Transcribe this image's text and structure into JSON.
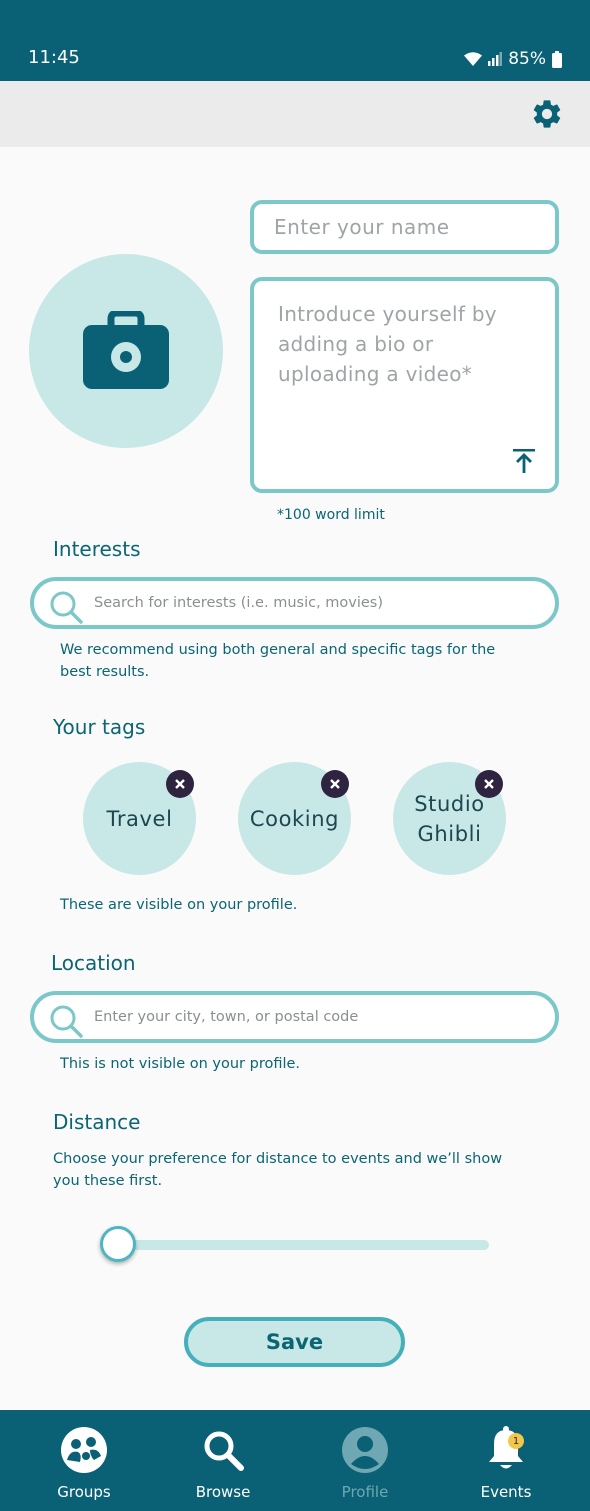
{
  "status_bar": {
    "time": "11:45",
    "battery": "85%"
  },
  "profile": {
    "name_placeholder": "Enter your name",
    "bio_placeholder": "Introduce yourself by adding a bio or uploading a video*",
    "word_limit_note": "*100 word limit"
  },
  "interests": {
    "title": "Interests",
    "search_placeholder": "Search for interests (i.e. music, movies)",
    "helper": "We recommend using both general and specific tags for the best results."
  },
  "tags": {
    "title": "Your tags",
    "items": [
      {
        "label": "Travel"
      },
      {
        "label": "Cooking"
      },
      {
        "label": "Studio Ghibli"
      }
    ],
    "helper": "These are visible on your profile."
  },
  "location": {
    "title": "Location",
    "search_placeholder": "Enter your city, town, or postal code",
    "helper": "This is not visible on your profile."
  },
  "distance": {
    "title": "Distance",
    "helper": "Choose your preference for distance to events and we’ll show you these first.",
    "slider_value_fraction": 0.0
  },
  "save_label": "Save",
  "bottom_nav": {
    "items": [
      {
        "label": "Groups",
        "icon": "groups-icon"
      },
      {
        "label": "Browse",
        "icon": "search-icon"
      },
      {
        "label": "Profile",
        "icon": "profile-icon",
        "active": true
      },
      {
        "label": "Events",
        "icon": "bell-icon",
        "badge": "1"
      }
    ]
  },
  "colors": {
    "primary": "#0a6175",
    "accent_light": "#c7e8e6",
    "border": "#7cc8c8",
    "badge": "#f2c84b",
    "tag_remove": "#2e2440"
  }
}
